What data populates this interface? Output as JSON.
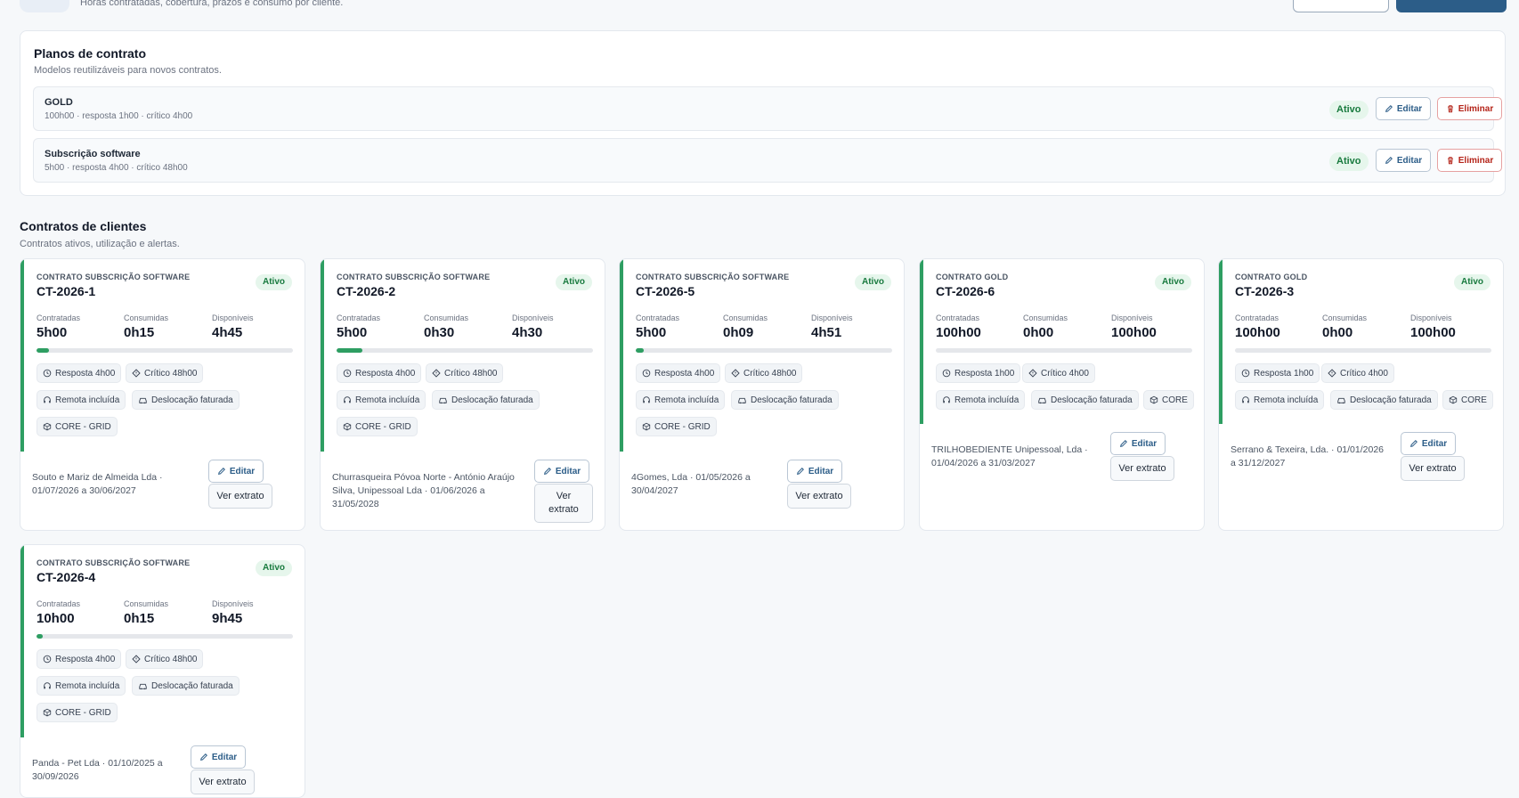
{
  "header": {
    "subtitle": "Horas contratadas, cobertura, prazos e consumo por cliente."
  },
  "plans": {
    "title": "Planos de contrato",
    "subtitle": "Modelos reutilizáveis para novos contratos.",
    "edit_label": "Editar",
    "delete_label": "Eliminar",
    "items": [
      {
        "name": "GOLD",
        "meta": "100h00 · resposta 1h00 · crítico 4h00",
        "status": "Ativo"
      },
      {
        "name": "Subscrição software",
        "meta": "5h00 · resposta 4h00 · crítico 48h00",
        "status": "Ativo"
      }
    ]
  },
  "contracts": {
    "title": "Contratos de clientes",
    "subtitle": "Contratos ativos, utilização e alertas.",
    "labels": {
      "contracted": "Contratadas",
      "consumed": "Consumidas",
      "available": "Disponíveis",
      "edit": "Editar",
      "statement": "Ver extrato",
      "statement_wrapped": "Ver\nextrato"
    },
    "accent_color": "#2e9e62",
    "items": [
      {
        "kind": "CONTRATO SUBSCRIÇÃO SOFTWARE",
        "id": "CT-2026-1",
        "status": "Ativo",
        "contracted": "5h00",
        "consumed": "0h15",
        "available": "4h45",
        "usage_fraction": 0.05,
        "response": "Resposta 4h00",
        "critical": "Crítico 48h00",
        "remote": "Remota incluída",
        "travel": "Deslocação faturada",
        "scope": "CORE - GRID",
        "client": "Souto e Mariz de Almeida Lda · 01/07/2026 a 30/06/2027"
      },
      {
        "kind": "CONTRATO SUBSCRIÇÃO SOFTWARE",
        "id": "CT-2026-2",
        "status": "Ativo",
        "contracted": "5h00",
        "consumed": "0h30",
        "available": "4h30",
        "usage_fraction": 0.1,
        "response": "Resposta 4h00",
        "critical": "Crítico 48h00",
        "remote": "Remota incluída",
        "travel": "Deslocação faturada",
        "scope": "CORE - GRID",
        "client": "Churrasqueira Póvoa Norte - António Araújo Silva, Unipessoal Lda · 01/06/2026 a 31/05/2028"
      },
      {
        "kind": "CONTRATO SUBSCRIÇÃO SOFTWARE",
        "id": "CT-2026-5",
        "status": "Ativo",
        "contracted": "5h00",
        "consumed": "0h09",
        "available": "4h51",
        "usage_fraction": 0.03,
        "response": "Resposta 4h00",
        "critical": "Crítico 48h00",
        "remote": "Remota incluída",
        "travel": "Deslocação faturada",
        "scope": "CORE - GRID",
        "client": "4Gomes, Lda · 01/05/2026 a 30/04/2027"
      },
      {
        "kind": "CONTRATO GOLD",
        "id": "CT-2026-6",
        "status": "Ativo",
        "contracted": "100h00",
        "consumed": "0h00",
        "available": "100h00",
        "usage_fraction": 0,
        "response": "Resposta 1h00",
        "critical": "Crítico 4h00",
        "remote": "Remota incluída",
        "travel": "Deslocação faturada",
        "scope": "CORE",
        "client": "TRILHOBEDIENTE Unipessoal, Lda · 01/04/2026 a 31/03/2027"
      },
      {
        "kind": "CONTRATO GOLD",
        "id": "CT-2026-3",
        "status": "Ativo",
        "contracted": "100h00",
        "consumed": "0h00",
        "available": "100h00",
        "usage_fraction": 0,
        "response": "Resposta 1h00",
        "critical": "Crítico 4h00",
        "remote": "Remota incluída",
        "travel": "Deslocação faturada",
        "scope": "CORE",
        "client": "Serrano & Texeira, Lda. · 01/01/2026 a 31/12/2027"
      },
      {
        "kind": "CONTRATO SUBSCRIÇÃO SOFTWARE",
        "id": "CT-2026-4",
        "status": "Ativo",
        "contracted": "10h00",
        "consumed": "0h15",
        "available": "9h45",
        "usage_fraction": 0.025,
        "response": "Resposta 4h00",
        "critical": "Crítico 48h00",
        "remote": "Remota incluída",
        "travel": "Deslocação faturada",
        "scope": "CORE - GRID",
        "client": "Panda - Pet Lda · 01/10/2025 a 30/09/2026"
      }
    ]
  }
}
